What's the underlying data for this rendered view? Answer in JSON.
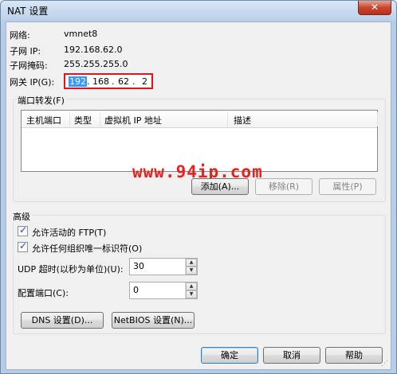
{
  "window": {
    "title": "NAT 设置",
    "close_glyph": "✕"
  },
  "info": {
    "network_label": "网络:",
    "network_value": "vmnet8",
    "subnet_ip_label": "子网 IP:",
    "subnet_ip_value": "192.168.62.0",
    "subnet_mask_label": "子网掩码:",
    "subnet_mask_value": "255.255.255.0",
    "gateway_label": "网关 IP(G):",
    "gateway_octets": [
      "192",
      "168",
      "62",
      "2"
    ]
  },
  "port_forwarding": {
    "legend": "端口转发(F)",
    "columns": [
      "主机端口",
      "类型",
      "虚拟机 IP 地址",
      "描述"
    ],
    "rows": [],
    "add_button": "添加(A)...",
    "remove_button": "移除(R)",
    "properties_button": "属性(P)"
  },
  "watermark": "www.94ip.com",
  "advanced": {
    "legend": "高级",
    "allow_active_ftp_label": "允许活动的 FTP(T)",
    "allow_active_ftp": true,
    "allow_any_oui_label": "允许任何组织唯一标识符(O)",
    "allow_any_oui": true,
    "udp_timeout_label": "UDP 超时(以秒为单位)(U):",
    "udp_timeout_value": "30",
    "config_port_label": "配置端口(C):",
    "config_port_value": "0",
    "dns_button": "DNS 设置(D)...",
    "netbios_button": "NetBIOS 设置(N)..."
  },
  "footer": {
    "ok_button": "确定",
    "cancel_button": "取消",
    "help_button": "帮助"
  },
  "icons": {
    "close": "close-icon",
    "spin_up": "chevron-up-icon",
    "spin_down": "chevron-down-icon",
    "check": "checkmark-icon"
  },
  "colors": {
    "highlight_border": "#e0141c",
    "selection": "#3399ff",
    "watermark": "#e8211e"
  }
}
